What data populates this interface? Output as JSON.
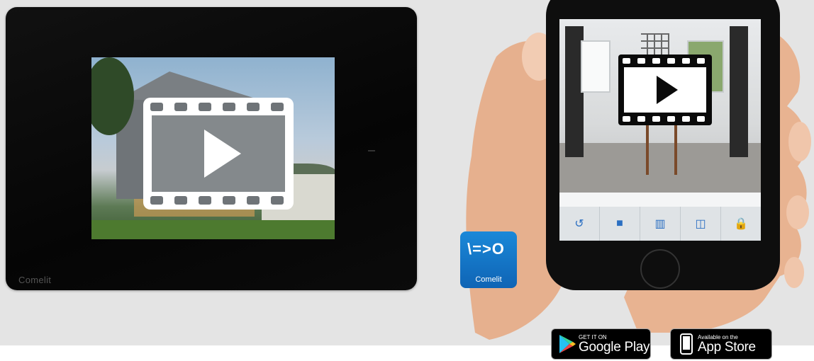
{
  "monitor": {
    "brand": "Comelit"
  },
  "phone": {
    "toolbar": [
      {
        "name": "refresh-button",
        "glyph": "↺"
      },
      {
        "name": "video-button",
        "glyph": "■"
      },
      {
        "name": "light-button",
        "glyph": "▥"
      },
      {
        "name": "camera-switch-button",
        "glyph": "◫"
      },
      {
        "name": "lock-button",
        "glyph": "🔒"
      }
    ]
  },
  "app_icon": {
    "logo_text": "\\=>O",
    "brand": "Comelit"
  },
  "google_play": {
    "small": "GET IT ON",
    "big": "Google Play"
  },
  "app_store": {
    "small": "Available on the",
    "big": "App Store"
  }
}
